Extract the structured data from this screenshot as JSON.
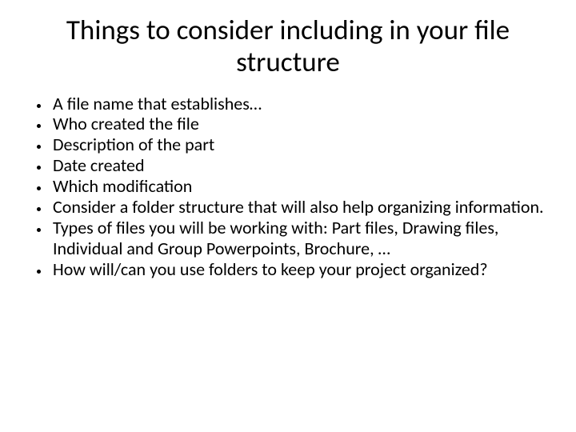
{
  "slide": {
    "title": "Things to consider including in your file structure",
    "bullets": [
      "A file name that establishes…",
      "Who created the file",
      "Description of the part",
      "Date created",
      "Which modification",
      "Consider a folder structure that will also help organizing information.",
      "Types of files you will be working with: Part files, Drawing files, Individual and Group Powerpoints, Brochure, …",
      "How will/can you use folders to keep your project organized?"
    ]
  }
}
